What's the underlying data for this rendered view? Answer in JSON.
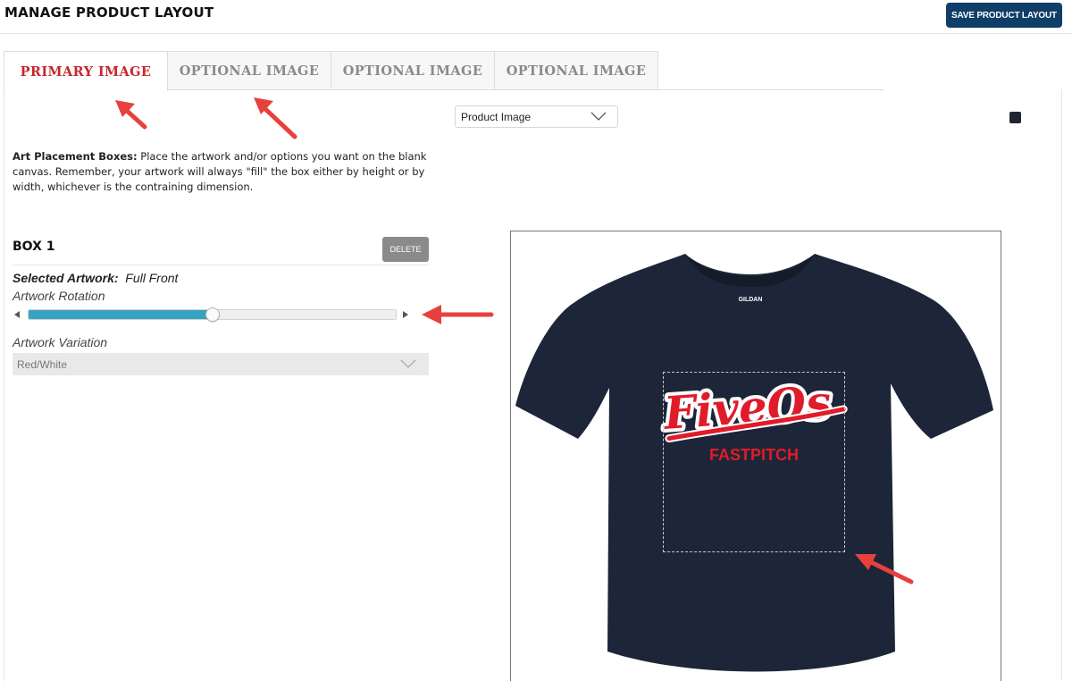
{
  "page": {
    "title": "MANAGE PRODUCT LAYOUT",
    "save_label": "SAVE PRODUCT LAYOUT"
  },
  "tabs": [
    {
      "label": "PRIMARY IMAGE",
      "active": true
    },
    {
      "label": "OPTIONAL IMAGE",
      "active": false
    },
    {
      "label": "OPTIONAL IMAGE",
      "active": false
    },
    {
      "label": "OPTIONAL IMAGE",
      "active": false
    }
  ],
  "image_select": {
    "value": "Product Image"
  },
  "color_swatch": "#1e2533",
  "instructions": {
    "label": "Art Placement Boxes:",
    "text": " Place the artwork and/or options you want on the blank canvas. Remember, your artwork will always \"fill\" the box either by height or by width, whichever is the contraining dimension."
  },
  "box": {
    "title": "BOX 1",
    "delete_label": "DELETE",
    "selected_artwork_label": "Selected Artwork:",
    "selected_artwork_value": "Full Front",
    "rotation_label": "Artwork Rotation",
    "rotation_fraction": 0.5,
    "variation_label": "Artwork Variation",
    "variation_value": "Red/White"
  },
  "artwork": {
    "line1": "FiveOs",
    "line2": "FASTPITCH",
    "shirt_tag": "GILDAN",
    "shirt_color": "#1d2638",
    "art_color": "#e01b2a"
  },
  "colors": {
    "accent_red": "#c8262d",
    "save_button": "#0f3e68",
    "slider_fill": "#36a3c0",
    "annotation_arrow": "#e8413d"
  }
}
